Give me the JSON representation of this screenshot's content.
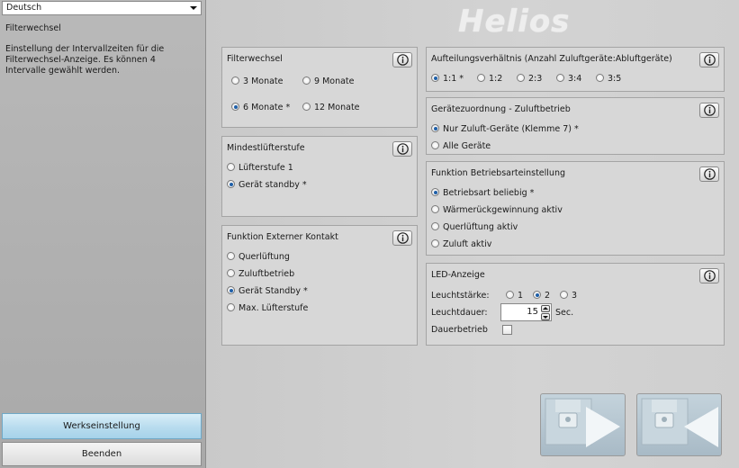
{
  "sidebar": {
    "language": "Deutsch",
    "title": "Filterwechsel",
    "description": "Einstellung der Intervallzeiten für die Filterwechsel-Anzeige. Es können 4 Intervalle gewählt werden.",
    "factory_button": "Werkseinstellung",
    "quit_button": "Beenden"
  },
  "logo": "Helios",
  "filter": {
    "title": "Filterwechsel",
    "options": [
      "3 Monate",
      "9 Monate",
      "6 Monate *",
      "12 Monate"
    ],
    "selected": "6 Monate *"
  },
  "min_fan": {
    "title": "Mindestlüfterstufe",
    "options": [
      "Lüfterstufe 1",
      "Gerät standby *"
    ],
    "selected": "Gerät standby *"
  },
  "ext_contact": {
    "title": "Funktion Externer Kontakt",
    "options": [
      "Querlüftung",
      "Zuluftbetrieb",
      "Gerät Standby *",
      "Max. Lüfterstufe"
    ],
    "selected": "Gerät Standby *"
  },
  "ratio": {
    "title": "Aufteilungsverhältnis (Anzahl Zuluftgeräte:Abluftgeräte)",
    "options": [
      "1:1 *",
      "1:2",
      "2:3",
      "3:4",
      "3:5"
    ],
    "selected": "1:1 *"
  },
  "assignment": {
    "title": "Gerätezuordnung - Zuluftbetrieb",
    "options": [
      "Nur Zuluft-Geräte (Klemme 7) *",
      "Alle Geräte"
    ],
    "selected": "Nur Zuluft-Geräte (Klemme 7) *"
  },
  "mode": {
    "title": "Funktion Betriebsarteinstellung",
    "options": [
      "Betriebsart beliebig *",
      "Wärmerückgewinnung aktiv",
      "Querlüftung aktiv",
      "Zuluft aktiv"
    ],
    "selected": "Betriebsart beliebig *"
  },
  "led": {
    "title": "LED-Anzeige",
    "brightness_label": "Leuchtstärke:",
    "brightness_options": [
      "1",
      "2",
      "3"
    ],
    "brightness_selected": "2",
    "duration_label": "Leuchtdauer:",
    "duration_value": "15",
    "duration_unit": "Sec.",
    "continuous_label": "Dauerbetrieb",
    "continuous_checked": false
  },
  "colors": {
    "accent_radio": "#1e5fa8",
    "factory_button": "#b8dcee",
    "nav_button": "#b4c5d0"
  },
  "icons": [
    "info-icon",
    "save-forward-icon",
    "save-back-icon",
    "dropdown-arrow-icon"
  ]
}
